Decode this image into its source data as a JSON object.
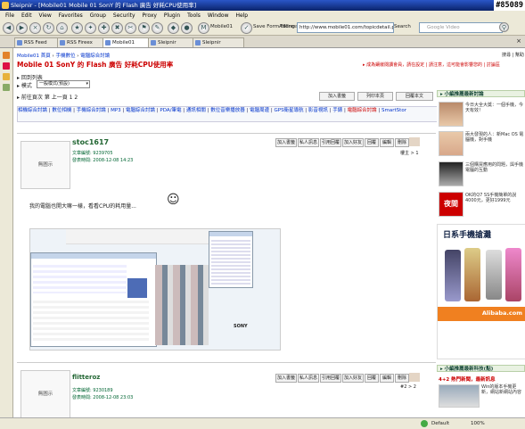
{
  "window": {
    "title": "Sleipnir - [Mobile01 Mobile 01 SonY 的 Flash 廣告 好耗CPU使用率]",
    "tag": "#85089"
  },
  "menu": [
    "File",
    "Edit",
    "View",
    "Favorites",
    "Group",
    "Security",
    "Proxy",
    "Plugin",
    "Tools",
    "Window",
    "Help"
  ],
  "toolbar": {
    "mobile01_label": "Mobile01",
    "save_form_label": "Save Form Filling",
    "address_label": "Address",
    "address_value": "http://www.mobile01.com/topicdetail.php?f=37",
    "search_label": "Search",
    "search_placeholder": "Google Video"
  },
  "tabs": [
    "RSS Feed",
    "RSS Fireex",
    "Mobile01",
    "Sleipnir",
    "Sleipnir"
  ],
  "breadcrumb": {
    "root": "Mobile01 首頁",
    "part1": "手機數位",
    "part2": "電腦綜合討論",
    "right": "搜尋 | 幫助"
  },
  "topic_title": "Mobile 01 SonY 的 Flash 廣告 好耗CPU使用率",
  "topic_right": "▸ 成為鑲嵌閱讀會員，請在設定 | 請注意，這可能會影響您的 | 討論區",
  "return_link": "▸ 回到列表",
  "mode_label": "▸ 模式",
  "mode_select": "一般模式(預設)",
  "paging": "▸ 前往頁次  第 上一頁  1  2",
  "action_buttons": [
    "加入書籤",
    "列印本頁",
    "回覆本文"
  ],
  "forum_nav": [
    "相機綜合討論",
    "數位相機",
    "手機綜合討論",
    "MP3",
    "電腦綜合討論",
    "PDA/筆電",
    "通訊相關",
    "數位音樂播放器",
    "電腦周邊",
    "GPS衛星導航",
    "影音視訊",
    "手錶",
    "電腦綜合討論",
    "SmartStor"
  ],
  "post1": {
    "author": "stoc1617",
    "stats_label": "文章編號: 9239705",
    "date_label": "發表時間: 2008-12-08 14:23",
    "avatar_label": "無圖示",
    "buttons": [
      "加入書籤",
      "私人訊息",
      "引用回覆",
      "加入好友",
      "回覆",
      "編輯",
      "刪除"
    ],
    "floor": "樓主 > 1",
    "body": "我的電腦也開大嘛一樣，看看CPU的耗用量...",
    "screenshot_watermark": "SONY"
  },
  "post2": {
    "author": "flitteroz",
    "stats_label": "文章編號: 9230189",
    "date_label": "發表時間: 2008-12-08 23:03",
    "avatar_label": "無圖示",
    "buttons": [
      "加入書籤",
      "私人訊息",
      "引用回覆",
      "加入好友",
      "回覆",
      "編輯",
      "刪除"
    ],
    "floor": "#2 > 2"
  },
  "sidebar": {
    "head1": "▸ 小編推薦最新討論",
    "items": [
      "今日大全大獎：一個手機，今天有效！",
      "兩大發現的人：新Mac OS 電腦機，對手機",
      "三個購買應用的問題，與手機電腦的互動",
      "OK的Q7 SS手機簡單的說4000元，更好1999元"
    ],
    "night_label": "夜間",
    "japan_banner": "日系手機搶灘",
    "alibaba": "Alibaba.com",
    "head2": "▸ 小編推薦最新科技(點)",
    "news1": "4+2 熱門新聞，最新訊息",
    "news2": "Win的版本手機更新，網站新網站內容"
  },
  "statusbar": {
    "left": "",
    "default_label": "Default",
    "zoom": "100%"
  }
}
